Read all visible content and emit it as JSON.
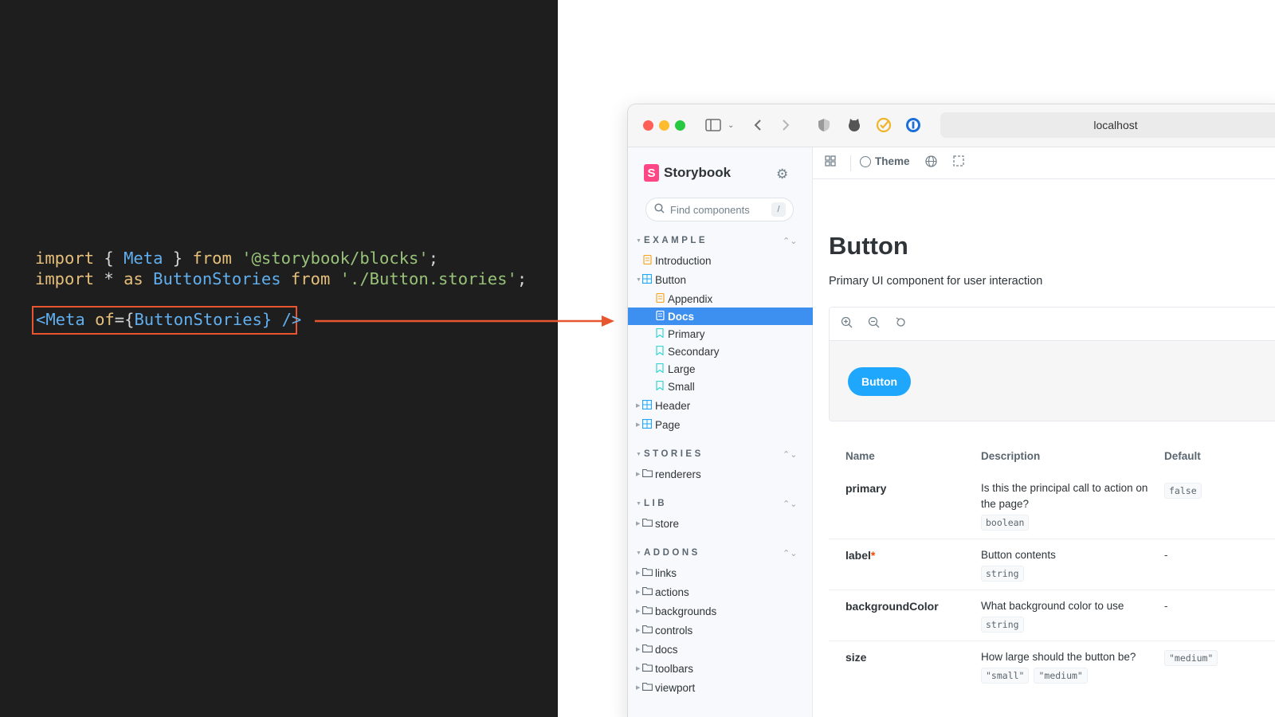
{
  "code": {
    "line1": {
      "kw1": "import",
      "p1": " { ",
      "id1": "Meta",
      "p2": " } ",
      "kw2": "from",
      "p3": " ",
      "str": "'@storybook/blocks'",
      "p4": ";"
    },
    "line2": {
      "kw1": "import",
      "p1": " * ",
      "kw2": "as",
      "p2": " ",
      "id1": "ButtonStories",
      "p3": " ",
      "kw3": "from",
      "p4": " ",
      "str": "'./Button.stories'",
      "p5": ";"
    },
    "line3": {
      "p1": "<",
      "id1": "Meta",
      "p2": " ",
      "kw1": "of",
      "p3": "={",
      "id2": "ButtonStories",
      "p4": "} />"
    }
  },
  "browser": {
    "url": "localhost"
  },
  "sidebar": {
    "brand": "Storybook",
    "search_placeholder": "Find components",
    "search_shortcut": "/",
    "sections": {
      "example": "EXAMPLE",
      "stories": "STORIES",
      "lib": "LIB",
      "addons": "ADDONS"
    },
    "items": {
      "introduction": "Introduction",
      "button": "Button",
      "appendix": "Appendix",
      "docs": "Docs",
      "primary": "Primary",
      "secondary": "Secondary",
      "large": "Large",
      "small": "Small",
      "header": "Header",
      "page": "Page",
      "renderers": "renderers",
      "store": "store",
      "links": "links",
      "actions": "actions",
      "backgrounds": "backgrounds",
      "controls": "controls",
      "docs_folder": "docs",
      "toolbars": "toolbars",
      "viewport": "viewport"
    }
  },
  "toolbar": {
    "theme_label": "Theme"
  },
  "doc": {
    "title": "Button",
    "subtitle": "Primary UI component for user interaction",
    "preview_button_label": "Button"
  },
  "args_table": {
    "headers": {
      "name": "Name",
      "description": "Description",
      "default": "Default"
    },
    "rows": [
      {
        "name": "primary",
        "description": "Is this the principal call to action on the page?",
        "type": "boolean",
        "default": "false"
      },
      {
        "name": "label",
        "description": "Button contents",
        "type": "string",
        "default": "-"
      },
      {
        "name": "backgroundColor",
        "description": "What background color to use",
        "type": "string",
        "default": "-"
      },
      {
        "name": "size",
        "description": "How large should the button be?",
        "type1": "\"small\"",
        "type2": "\"medium\"",
        "default": "\"medium\""
      }
    ]
  },
  "colors": {
    "highlight": "#e8552f",
    "selected": "#3d8ff0",
    "storybook_pink": "#ff4785",
    "story_button": "#1ea7fd"
  }
}
